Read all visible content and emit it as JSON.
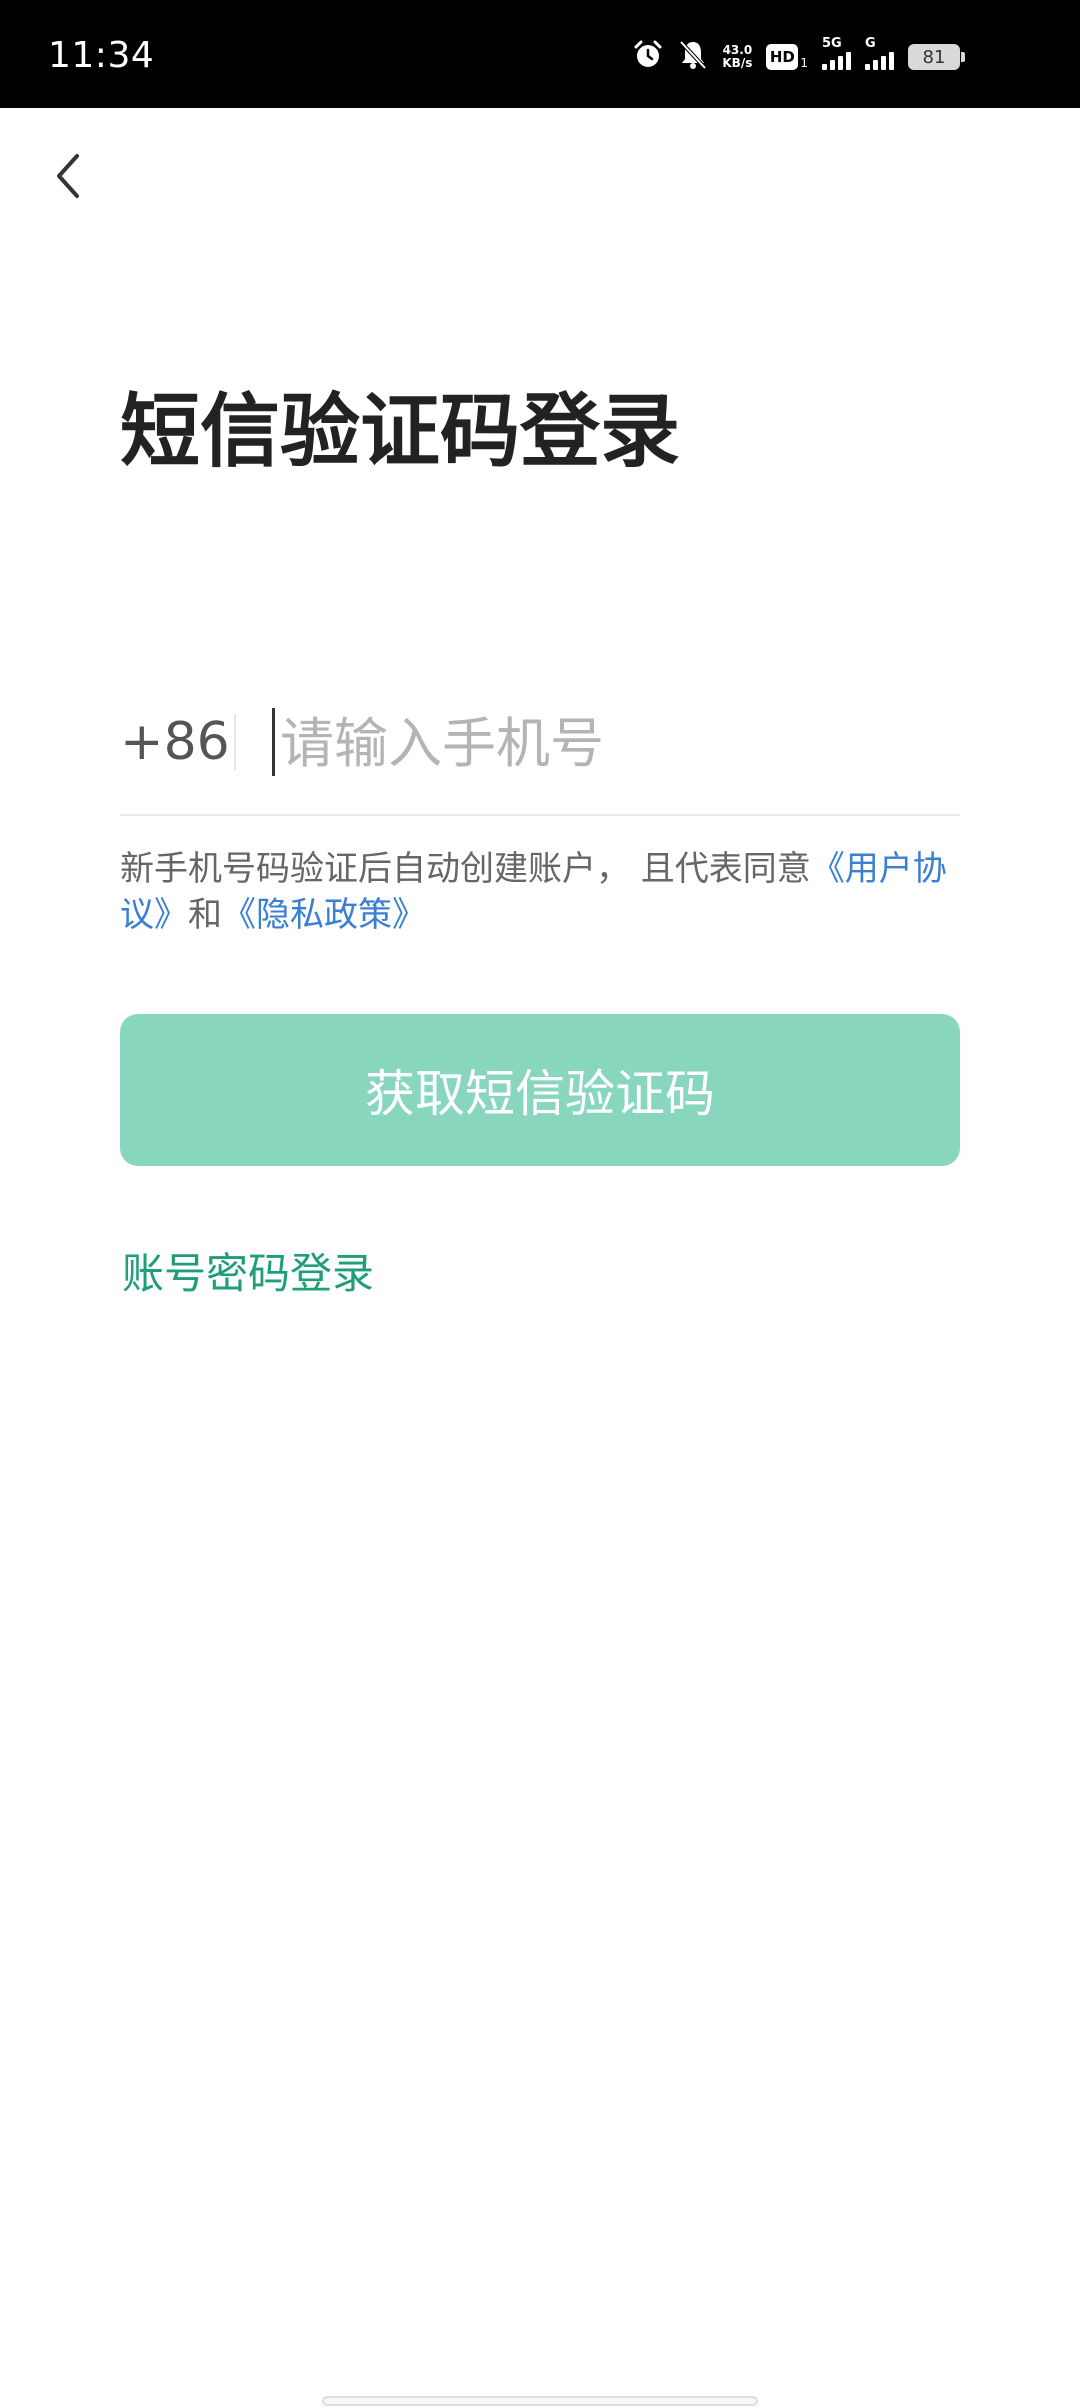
{
  "status_bar": {
    "time": "11:34",
    "net_speed_value": "43.0",
    "net_speed_unit": "KB/s",
    "hd_label": "HD",
    "hd_sub": "1",
    "network_5g": "5G",
    "network_g": "G",
    "battery": "81",
    "icons": [
      "alarm-icon",
      "bell-muted-icon",
      "signal-icon",
      "battery-icon"
    ]
  },
  "page": {
    "title": "短信验证码登录",
    "back_icon": "chevron-left-icon"
  },
  "phone_input": {
    "country_code": "+86",
    "placeholder": "请输入手机号",
    "value": ""
  },
  "agreement": {
    "text_before": "新手机号码验证后自动创建账户， 且代表同意",
    "user_agreement": "《用户协议》",
    "and_text": "和",
    "privacy_policy": "《隐私政策》"
  },
  "buttons": {
    "get_sms_code": "获取短信验证码",
    "account_password_login": "账号密码登录"
  },
  "colors": {
    "primary_button": "#89d6bf",
    "link_blue": "#3a7fd5",
    "link_green": "#1f9e79",
    "title_text": "#222222"
  }
}
